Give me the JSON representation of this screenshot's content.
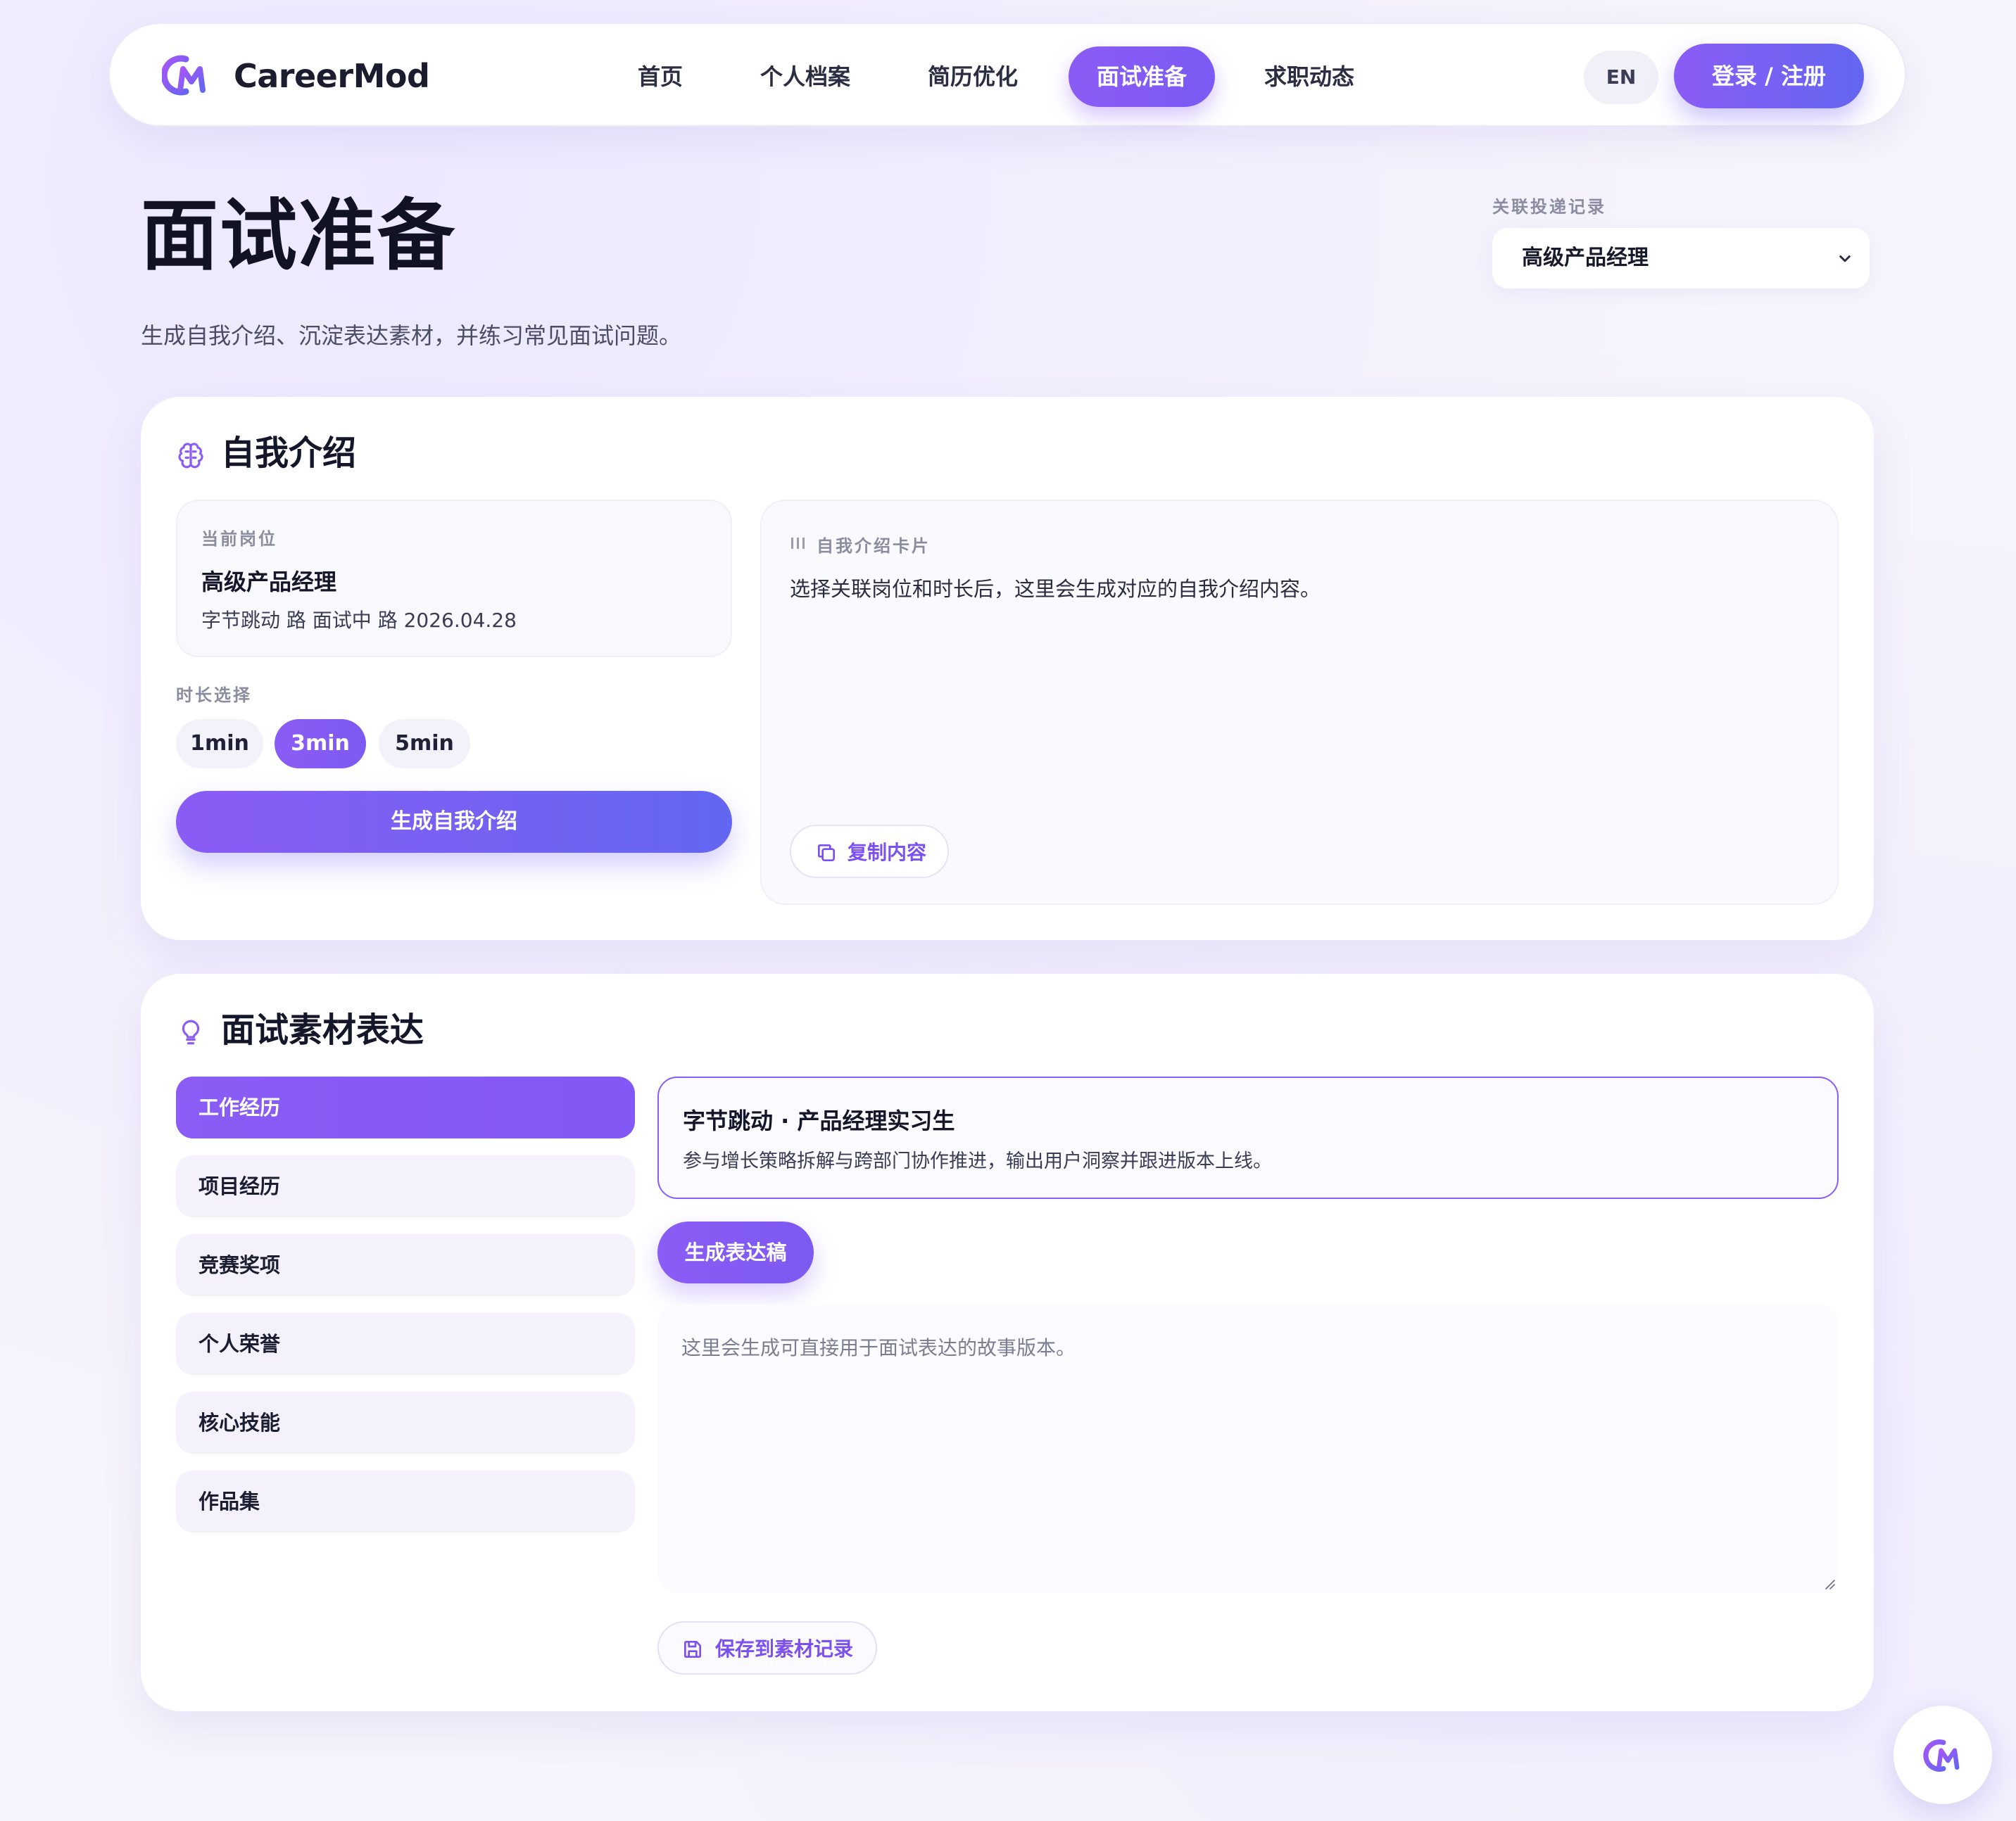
{
  "brand": {
    "name": "CareerMod"
  },
  "nav": {
    "items": [
      {
        "label": "首页",
        "active": false
      },
      {
        "label": "个人档案",
        "active": false
      },
      {
        "label": "简历优化",
        "active": false
      },
      {
        "label": "面试准备",
        "active": true
      },
      {
        "label": "求职动态",
        "active": false
      }
    ],
    "lang": "EN",
    "login": "登录 / 注册"
  },
  "header": {
    "title": "面试准备",
    "subtitle": "生成自我介绍、沉淀表达素材，并练习常见面试问题。",
    "application_label": "关联投递记录",
    "application_selected": "高级产品经理"
  },
  "self_intro": {
    "title": "自我介绍",
    "position_label": "当前岗位",
    "position_title": "高级产品经理",
    "position_sub": "字节跳动 路 面试中 路 2026.04.28",
    "duration_label": "时长选择",
    "durations": [
      {
        "label": "1min",
        "active": false
      },
      {
        "label": "3min",
        "active": true
      },
      {
        "label": "5min",
        "active": false
      }
    ],
    "generate_label": "生成自我介绍",
    "card_label": "自我介绍卡片",
    "card_text": "选择关联岗位和时长后，这里会生成对应的自我介绍内容。",
    "copy_label": "复制内容"
  },
  "materials": {
    "title": "面试素材表达",
    "tabs": [
      {
        "label": "工作经历",
        "active": true
      },
      {
        "label": "项目经历",
        "active": false
      },
      {
        "label": "竞赛奖项",
        "active": false
      },
      {
        "label": "个人荣誉",
        "active": false
      },
      {
        "label": "核心技能",
        "active": false
      },
      {
        "label": "作品集",
        "active": false
      }
    ],
    "experience_title": "字节跳动 · 产品经理实习生",
    "experience_desc": "参与增长策略拆解与跨部门协作推进，输出用户洞察并跟进版本上线。",
    "generate_label": "生成表达稿",
    "story_placeholder": "这里会生成可直接用于面试表达的故事版本。",
    "save_label": "保存到素材记录"
  },
  "colors": {
    "accent": "#8b5cf6",
    "accent_end": "#6366f1"
  },
  "icons": [
    "brain-icon",
    "lightbulb-icon",
    "copy-icon",
    "save-icon",
    "chevron-down-icon"
  ]
}
